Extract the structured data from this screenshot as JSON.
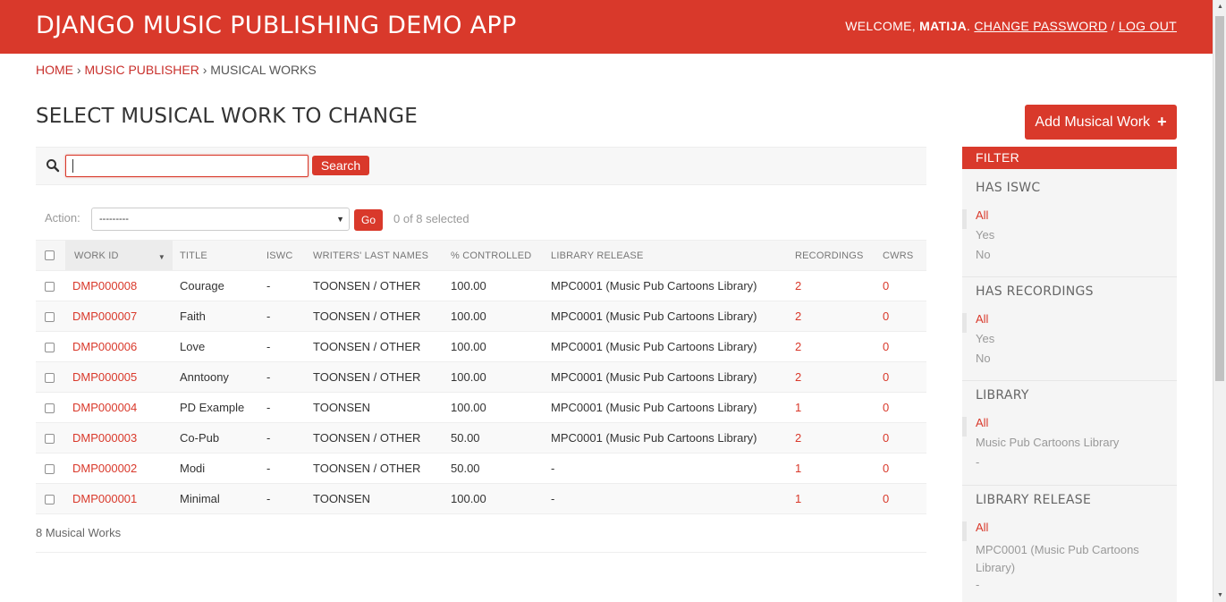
{
  "header": {
    "site_title": "DJANGO MUSIC PUBLISHING DEMO APP",
    "welcome": "WELCOME, ",
    "username": "MATIJA",
    "period": ". ",
    "change_password": "CHANGE PASSWORD",
    "separator": " / ",
    "logout": "LOG OUT"
  },
  "breadcrumbs": {
    "home": "HOME",
    "sep1": " › ",
    "app": "MUSIC PUBLISHER",
    "sep2": " › ",
    "current": "MUSICAL WORKS"
  },
  "page_title": "SELECT MUSICAL WORK TO CHANGE",
  "add_button": {
    "label": "Add Musical Work",
    "icon": "+"
  },
  "search": {
    "value": "",
    "button": "Search"
  },
  "actions": {
    "label": "Action:",
    "selected_option": "---------",
    "go": "Go",
    "selected_count": "0 of 8 selected"
  },
  "table": {
    "columns": [
      "WORK ID",
      "TITLE",
      "ISWC",
      "WRITERS' LAST NAMES",
      "% CONTROLLED",
      "LIBRARY RELEASE",
      "RECORDINGS",
      "CWRS"
    ],
    "rows": [
      [
        "DMP000008",
        "Courage",
        "-",
        "TOONSEN / OTHER",
        "100.00",
        "MPC0001 (Music Pub Cartoons Library)",
        "2",
        "0"
      ],
      [
        "DMP000007",
        "Faith",
        "-",
        "TOONSEN / OTHER",
        "100.00",
        "MPC0001 (Music Pub Cartoons Library)",
        "2",
        "0"
      ],
      [
        "DMP000006",
        "Love",
        "-",
        "TOONSEN / OTHER",
        "100.00",
        "MPC0001 (Music Pub Cartoons Library)",
        "2",
        "0"
      ],
      [
        "DMP000005",
        "Anntoony",
        "-",
        "TOONSEN / OTHER",
        "100.00",
        "MPC0001 (Music Pub Cartoons Library)",
        "2",
        "0"
      ],
      [
        "DMP000004",
        "PD Example",
        "-",
        "TOONSEN",
        "100.00",
        "MPC0001 (Music Pub Cartoons Library)",
        "1",
        "0"
      ],
      [
        "DMP000003",
        "Co-Pub",
        "-",
        "TOONSEN / OTHER",
        "50.00",
        "MPC0001 (Music Pub Cartoons Library)",
        "2",
        "0"
      ],
      [
        "DMP000002",
        "Modi",
        "-",
        "TOONSEN / OTHER",
        "50.00",
        "-",
        "1",
        "0"
      ],
      [
        "DMP000001",
        "Minimal",
        "-",
        "TOONSEN",
        "100.00",
        "-",
        "1",
        "0"
      ]
    ]
  },
  "result_count": "8 Musical Works",
  "filter": {
    "title": "FILTER",
    "sections": [
      {
        "title": "HAS ISWC",
        "options": [
          "All",
          "Yes",
          "No"
        ]
      },
      {
        "title": "HAS RECORDINGS",
        "options": [
          "All",
          "Yes",
          "No"
        ]
      },
      {
        "title": "LIBRARY",
        "options": [
          "All",
          "Music Pub Cartoons Library",
          "-"
        ]
      },
      {
        "title": "LIBRARY RELEASE",
        "options": [
          "All",
          "MPC0001 (Music Pub Cartoons Library)",
          "-"
        ]
      }
    ]
  },
  "colors": {
    "accent": "#d9392b",
    "link": "#d9392b"
  }
}
